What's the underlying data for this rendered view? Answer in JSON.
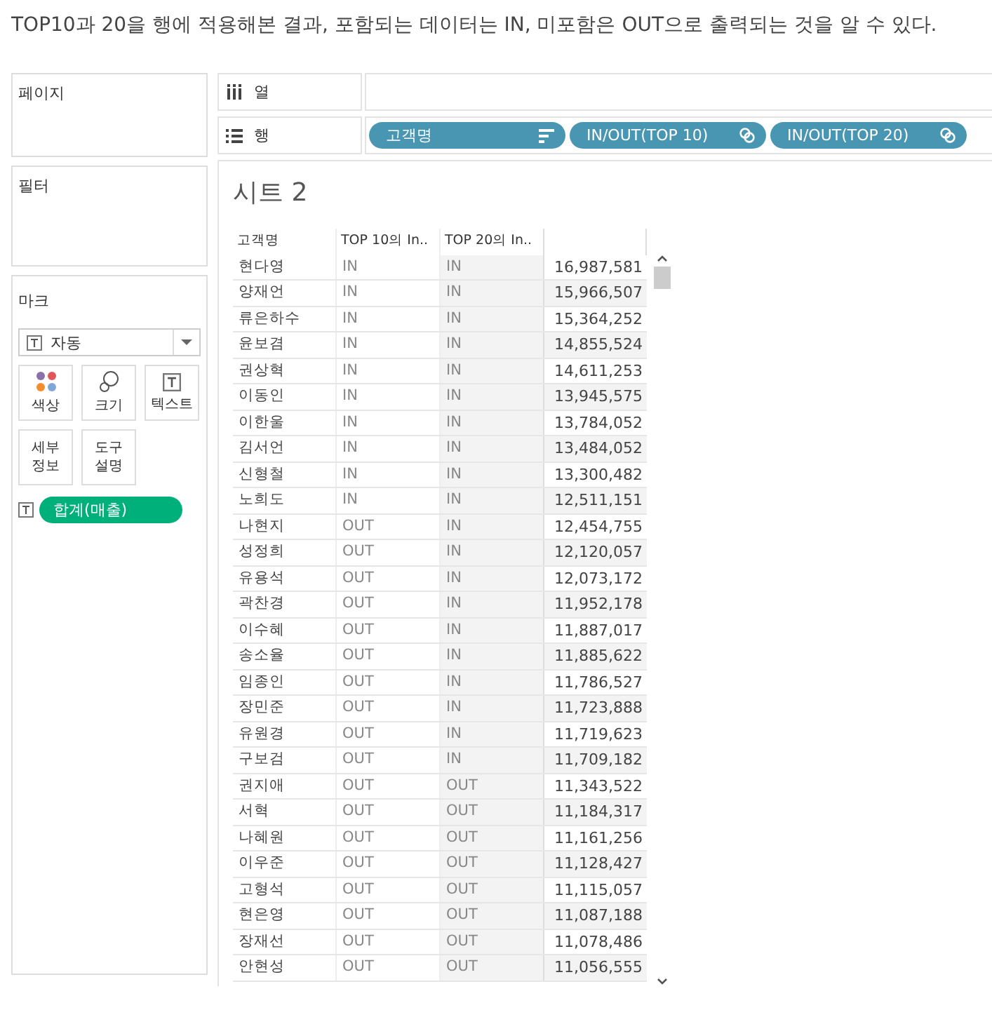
{
  "caption": "TOP10과 20을 행에 적용해본 결과, 포함되는 데이터는 IN, 미포함은 OUT으로 출력되는 것을 알 수 있다.",
  "pages_card": {
    "title": "페이지"
  },
  "filters_card": {
    "title": "필터"
  },
  "marks_card": {
    "title": "마크",
    "mark_type": "자동",
    "buttons": [
      {
        "kind": "color",
        "label": "색상"
      },
      {
        "kind": "size",
        "label": "크기"
      },
      {
        "kind": "text",
        "label": "텍스트"
      },
      {
        "kind": "detail",
        "label": "세부\n정보"
      },
      {
        "kind": "tooltip",
        "label": "도구\n설명"
      }
    ],
    "field": "합계(매출)"
  },
  "columns_shelf": {
    "label": "열"
  },
  "rows_shelf": {
    "label": "행",
    "pills": [
      {
        "label": "고객명",
        "kind": "sort"
      },
      {
        "label": "IN/OUT(TOP 10)",
        "kind": "set"
      },
      {
        "label": "IN/OUT(TOP 20)",
        "kind": "set"
      }
    ]
  },
  "sheet": {
    "title": "시트 2",
    "columns": [
      "고객명",
      "TOP 10의 In..",
      "TOP 20의 In.."
    ],
    "rows": [
      [
        "현다영",
        "IN",
        "IN",
        "16,987,581"
      ],
      [
        "양재언",
        "IN",
        "IN",
        "15,966,507"
      ],
      [
        "류은하수",
        "IN",
        "IN",
        "15,364,252"
      ],
      [
        "윤보겸",
        "IN",
        "IN",
        "14,855,524"
      ],
      [
        "권상혁",
        "IN",
        "IN",
        "14,611,253"
      ],
      [
        "이동인",
        "IN",
        "IN",
        "13,945,575"
      ],
      [
        "이한울",
        "IN",
        "IN",
        "13,784,052"
      ],
      [
        "김서언",
        "IN",
        "IN",
        "13,484,052"
      ],
      [
        "신형철",
        "IN",
        "IN",
        "13,300,482"
      ],
      [
        "노희도",
        "IN",
        "IN",
        "12,511,151"
      ],
      [
        "나현지",
        "OUT",
        "IN",
        "12,454,755"
      ],
      [
        "성정희",
        "OUT",
        "IN",
        "12,120,057"
      ],
      [
        "유용석",
        "OUT",
        "IN",
        "12,073,172"
      ],
      [
        "곽찬경",
        "OUT",
        "IN",
        "11,952,178"
      ],
      [
        "이수혜",
        "OUT",
        "IN",
        "11,887,017"
      ],
      [
        "송소율",
        "OUT",
        "IN",
        "11,885,622"
      ],
      [
        "임종인",
        "OUT",
        "IN",
        "11,786,527"
      ],
      [
        "장민준",
        "OUT",
        "IN",
        "11,723,888"
      ],
      [
        "유원경",
        "OUT",
        "IN",
        "11,719,623"
      ],
      [
        "구보검",
        "OUT",
        "IN",
        "11,709,182"
      ],
      [
        "권지애",
        "OUT",
        "OUT",
        "11,343,522"
      ],
      [
        "서혁",
        "OUT",
        "OUT",
        "11,184,317"
      ],
      [
        "나혜원",
        "OUT",
        "OUT",
        "11,161,256"
      ],
      [
        "이우준",
        "OUT",
        "OUT",
        "11,128,427"
      ],
      [
        "고형석",
        "OUT",
        "OUT",
        "11,115,057"
      ],
      [
        "현은영",
        "OUT",
        "OUT",
        "11,087,188"
      ],
      [
        "장재선",
        "OUT",
        "OUT",
        "11,078,486"
      ],
      [
        "안현성",
        "OUT",
        "OUT",
        "11,056,555"
      ]
    ]
  }
}
